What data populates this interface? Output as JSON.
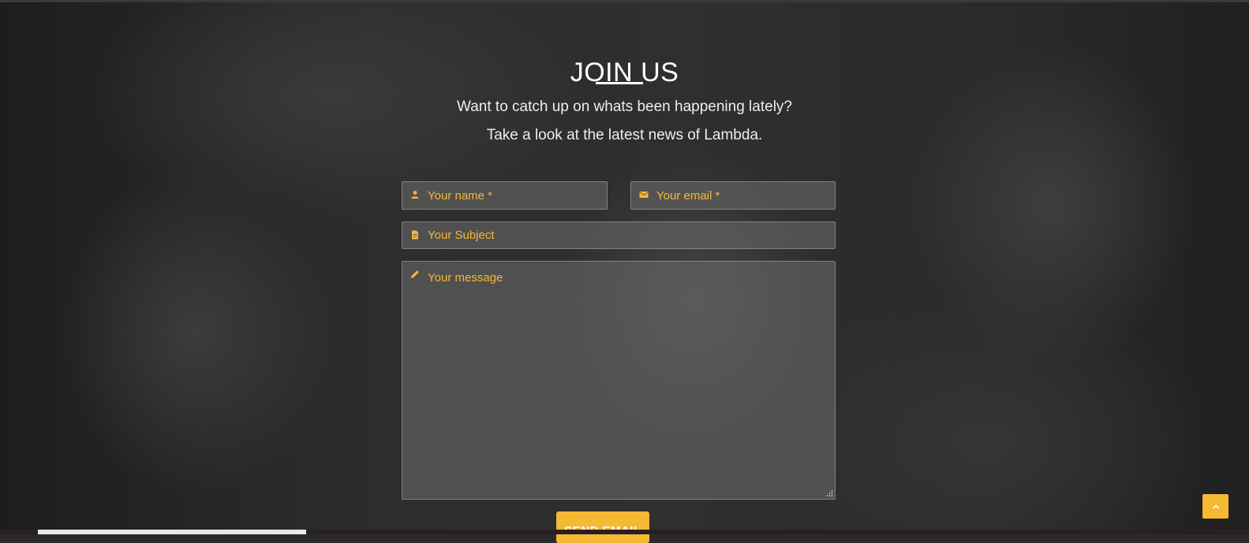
{
  "section": {
    "title": "JOIN US",
    "subtitle_line1": "Want to catch up on whats been happening lately?",
    "subtitle_line2": "Take a look at the latest news of Lambda."
  },
  "form": {
    "name_placeholder": "Your name *",
    "email_placeholder": "Your email *",
    "subject_placeholder": "Your Subject",
    "message_placeholder": "Your message",
    "send_label": "SEND EMAIL"
  },
  "icons": {
    "name": "user-icon",
    "email": "envelope-icon",
    "subject": "document-icon",
    "message": "pencil-icon",
    "scroll_top": "chevron-up-icon"
  },
  "colors": {
    "accent": "#f6b934",
    "text_light": "#ffffff"
  }
}
